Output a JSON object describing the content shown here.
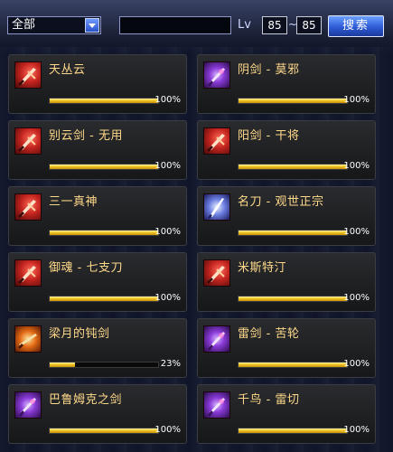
{
  "filters": {
    "type_value": "全部",
    "search_value": "",
    "lv_label": "Lv",
    "lv_min": "85",
    "lv_max": "85",
    "search_button_label": "搜索"
  },
  "colors": {
    "name_text": "#ffd98a",
    "bar_fill": "#f2c521",
    "button": "#2e5ad6"
  },
  "cards": [
    {
      "name": "天丛云",
      "percent_label": "100%",
      "progress": 1.0,
      "icon": "red-slash-icon",
      "icon_style": "red"
    },
    {
      "name": "阴剑 - 莫邪",
      "percent_label": "100%",
      "progress": 1.0,
      "icon": "purple-sword-icon",
      "icon_style": "purple"
    },
    {
      "name": "别云剑 - 无用",
      "percent_label": "100%",
      "progress": 1.0,
      "icon": "red-sword-icon",
      "icon_style": "red"
    },
    {
      "name": "阳剑 - 干将",
      "percent_label": "100%",
      "progress": 1.0,
      "icon": "red-sword-icon",
      "icon_style": "red"
    },
    {
      "name": "三一真神",
      "percent_label": "100%",
      "progress": 1.0,
      "icon": "red-slash-icon",
      "icon_style": "red"
    },
    {
      "name": "名刀 - 观世正宗",
      "percent_label": "100%",
      "progress": 1.0,
      "icon": "blue-blade-icon",
      "icon_style": "blue"
    },
    {
      "name": "御魂 - 七支刀",
      "percent_label": "100%",
      "progress": 1.0,
      "icon": "red-sword-icon",
      "icon_style": "red"
    },
    {
      "name": "米斯特汀",
      "percent_label": "100%",
      "progress": 1.0,
      "icon": "red-sword-icon",
      "icon_style": "red"
    },
    {
      "name": "梁月的钝剑",
      "percent_label": "23%",
      "progress": 0.23,
      "icon": "orange-sword-icon",
      "icon_style": "orange"
    },
    {
      "name": "雷剑 - 苦轮",
      "percent_label": "100%",
      "progress": 1.0,
      "icon": "blue-sword-icon",
      "icon_style": "purple"
    },
    {
      "name": "巴鲁姆克之剑",
      "percent_label": "100%",
      "progress": 1.0,
      "icon": "purple-sword-icon",
      "icon_style": "purple"
    },
    {
      "name": "千鸟 - 雷切",
      "percent_label": "100%",
      "progress": 1.0,
      "icon": "purple-sword-icon",
      "icon_style": "purple"
    }
  ]
}
